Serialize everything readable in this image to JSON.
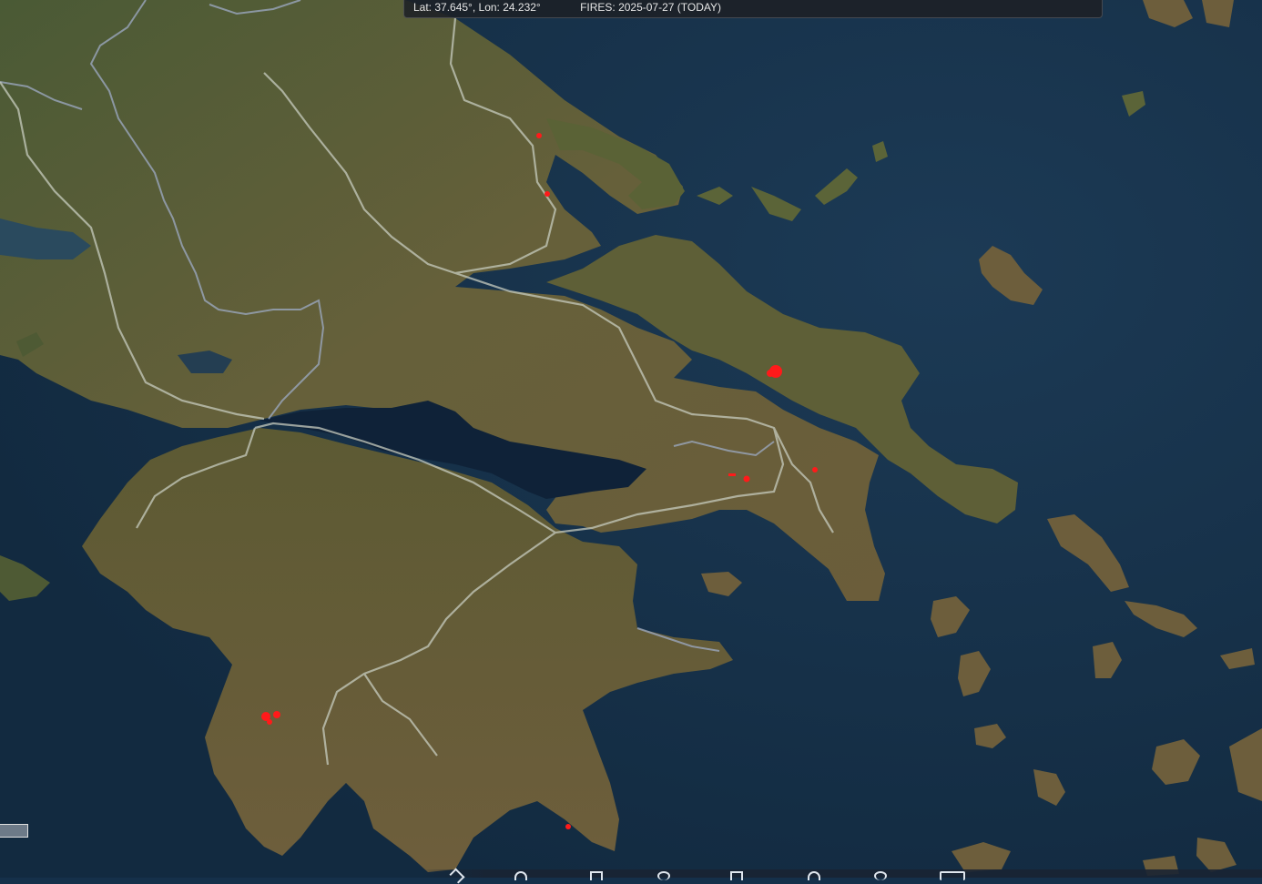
{
  "status": {
    "coords": "Lat: 37.645°, Lon: 24.232°",
    "fires": "FIRES: 2025-07-27 (TODAY)"
  },
  "map": {
    "basemap": "satellite",
    "colors": {
      "sea": "#15304a",
      "land": "#5e5a36",
      "borders": "#9aa6bd",
      "roads": "#c7ccbf",
      "fire": "#ff1a1a"
    }
  },
  "toolbar": {
    "icons": [
      "pencil-icon",
      "pin-icon",
      "bookmark-icon",
      "settings-icon",
      "layers-icon",
      "person-icon",
      "location-icon",
      "screen-icon"
    ]
  }
}
